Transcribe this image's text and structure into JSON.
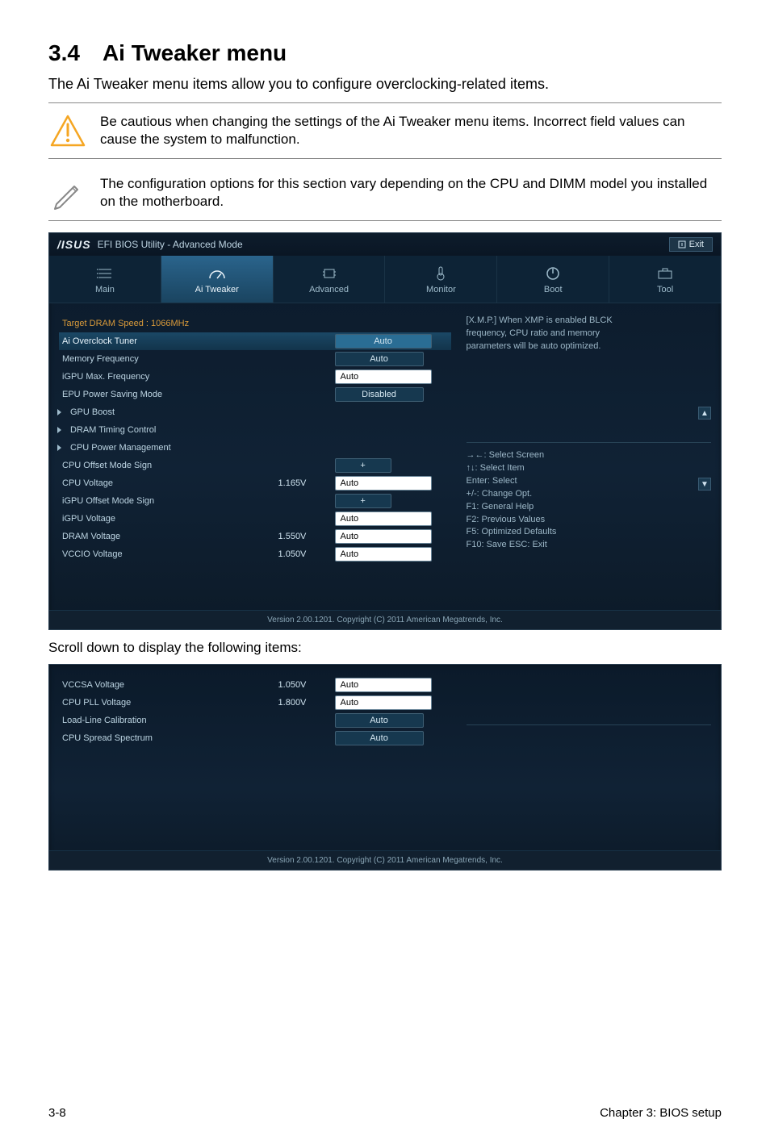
{
  "section": {
    "number": "3.4",
    "title": "Ai Tweaker menu"
  },
  "intro": "The Ai Tweaker menu items allow you to configure overclocking-related items.",
  "note_caution": "Be cautious when changing the settings of the Ai Tweaker menu items. Incorrect field values can cause the system to malfunction.",
  "note_info": "The configuration options for this section vary depending on the CPU and DIMM model you installed on the motherboard.",
  "bios": {
    "brand": "/ISUS",
    "subtitle": "EFI BIOS Utility - Advanced Mode",
    "exit": "Exit",
    "tabs": {
      "main": "Main",
      "ai_tweaker": "Ai Tweaker",
      "advanced": "Advanced",
      "monitor": "Monitor",
      "boot": "Boot",
      "tool": "Tool"
    },
    "rows": {
      "target_dram": "Target DRAM Speed : 1066MHz",
      "ai_overclock_tuner": {
        "label": "Ai Overclock Tuner",
        "value": "Auto"
      },
      "memory_frequency": {
        "label": "Memory Frequency",
        "value": "Auto"
      },
      "igpu_max_freq": {
        "label": "iGPU Max. Frequency",
        "value": "Auto"
      },
      "epu_power_saving": {
        "label": "EPU Power Saving Mode",
        "value": "Disabled"
      },
      "gpu_boost": "GPU Boost",
      "dram_timing": "DRAM Timing Control",
      "cpu_power_mgmt": "CPU Power Management",
      "cpu_offset_mode_sign": {
        "label": "CPU Offset Mode Sign",
        "value": "+"
      },
      "cpu_voltage": {
        "label": "CPU Voltage",
        "reading": "1.165V",
        "value": "Auto"
      },
      "igpu_offset_mode_sign": {
        "label": "iGPU Offset Mode Sign",
        "value": "+"
      },
      "igpu_voltage": {
        "label": "iGPU Voltage",
        "value": "Auto"
      },
      "dram_voltage": {
        "label": "DRAM Voltage",
        "reading": "1.550V",
        "value": "Auto"
      },
      "vccio_voltage": {
        "label": "VCCIO Voltage",
        "reading": "1.050V",
        "value": "Auto"
      }
    },
    "help": {
      "line1": "[X.M.P.] When XMP is enabled BLCK",
      "line2": "frequency, CPU ratio and memory",
      "line3": "parameters will be auto optimized.",
      "nav1": "→←: Select Screen",
      "nav2": "↑↓: Select Item",
      "nav3": "Enter: Select",
      "nav4": "+/-: Change Opt.",
      "nav5": "F1: General Help",
      "nav6": "F2: Previous Values",
      "nav7": "F5: Optimized Defaults",
      "nav8": "F10: Save   ESC: Exit"
    },
    "footer": "Version 2.00.1201.  Copyright (C) 2011 American Megatrends, Inc."
  },
  "scroll_note": "Scroll down to display the following items:",
  "bios2": {
    "rows": {
      "vccsa_voltage": {
        "label": "VCCSA Voltage",
        "reading": "1.050V",
        "value": "Auto"
      },
      "cpu_pll_voltage": {
        "label": "CPU PLL Voltage",
        "reading": "1.800V",
        "value": "Auto"
      },
      "load_line_calib": {
        "label": "Load-Line Calibration",
        "value": "Auto"
      },
      "cpu_spread_spectrum": {
        "label": "CPU Spread Spectrum",
        "value": "Auto"
      }
    }
  },
  "footer": {
    "left": "3-8",
    "right": "Chapter 3: BIOS setup"
  }
}
